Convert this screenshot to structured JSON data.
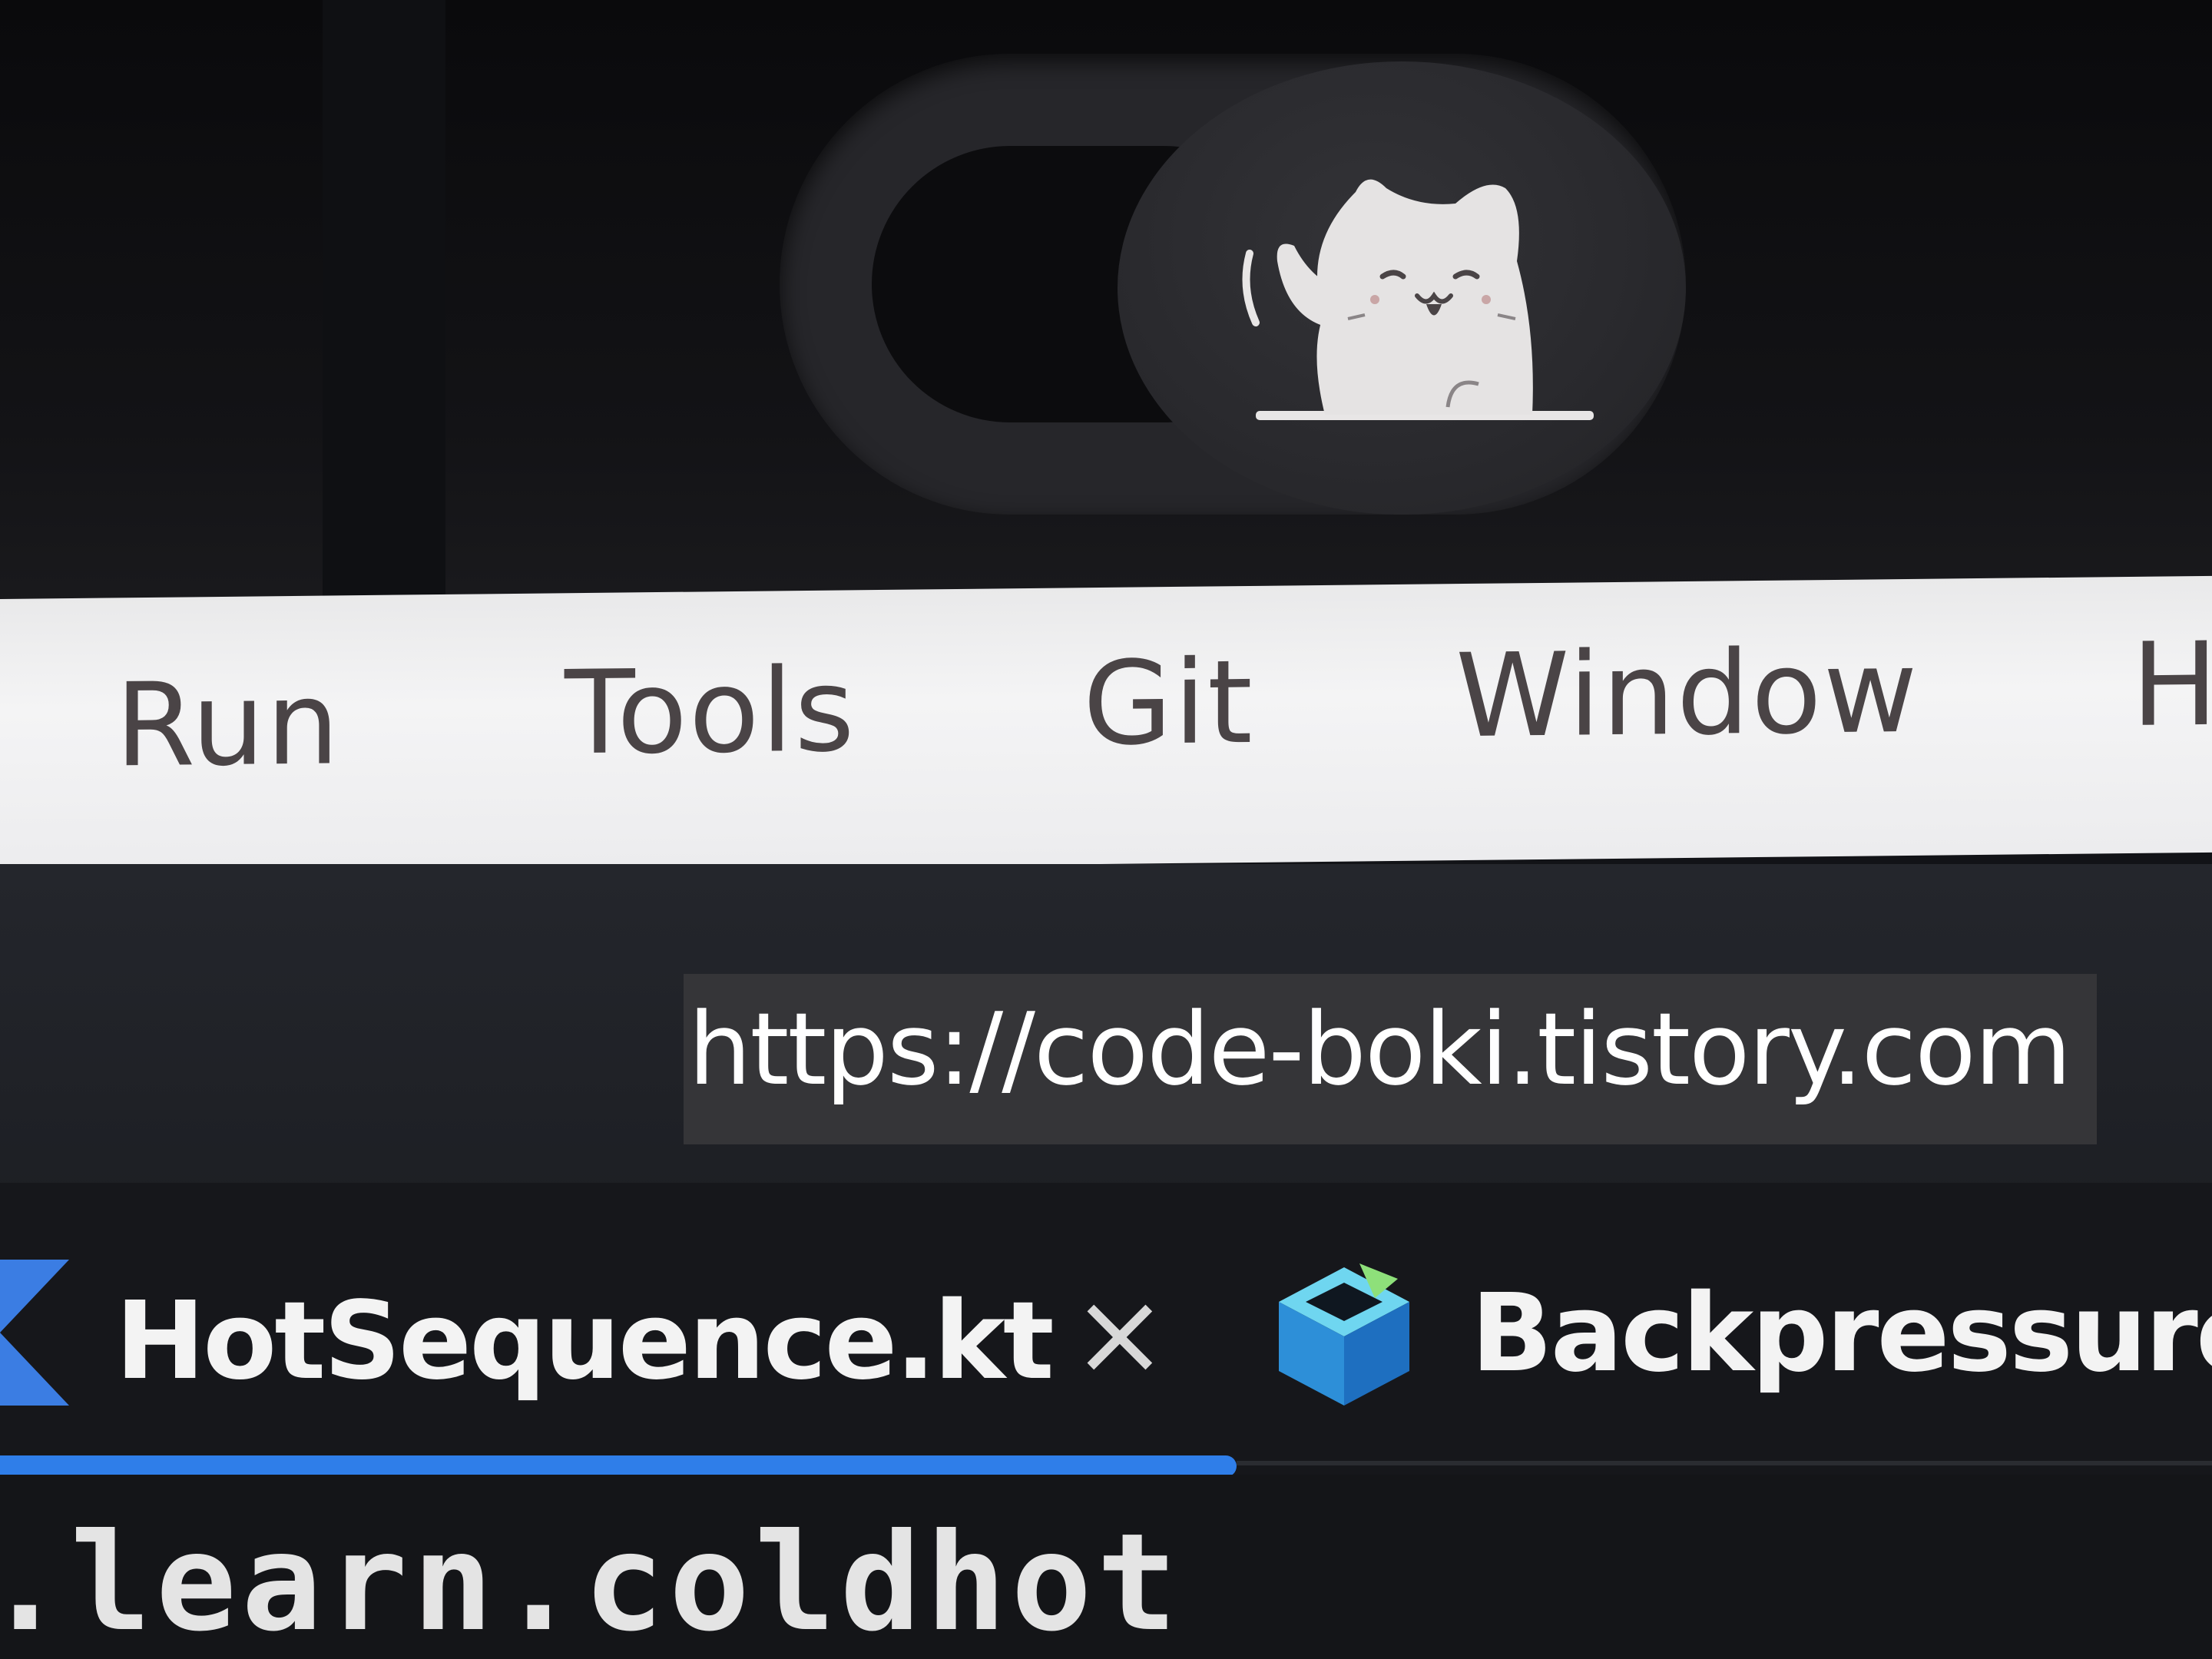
{
  "menu": {
    "items": [
      {
        "label": "Run"
      },
      {
        "label": "Tools"
      },
      {
        "label": "Git"
      },
      {
        "label": "Window"
      },
      {
        "label": "H"
      }
    ]
  },
  "watermark": {
    "text": "https://code-boki.tistory.com"
  },
  "tabs": [
    {
      "label": "HotSequence.kt",
      "icon": "kotlin-file-icon",
      "active": true,
      "close_glyph": "×"
    },
    {
      "label": "Backpressure",
      "icon": "module-cube-icon",
      "active": false
    }
  ],
  "editor": {
    "visible_line": ".learn.coldhot"
  },
  "colors": {
    "menubar_bg": "#f0f0f1",
    "menu_text": "#4a4446",
    "tab_underline": "#2f7ee9",
    "kotlin_icon": "#3b7de3",
    "webcam_cover": "#26262a"
  }
}
